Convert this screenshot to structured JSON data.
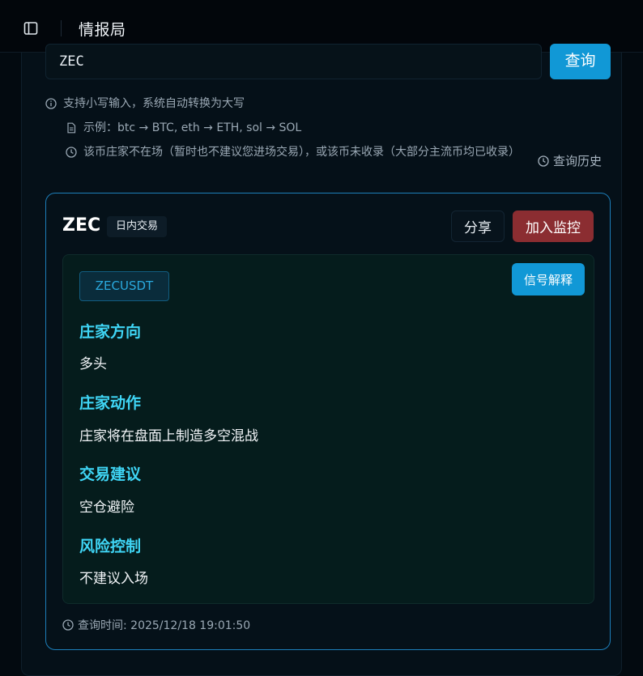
{
  "header": {
    "title": "情报局",
    "sidebar_toggle_icon": "sidebar-toggle-icon"
  },
  "search": {
    "value": "ZEC",
    "placeholder": "",
    "button_label": "查询"
  },
  "hints": {
    "info_text": "支持小写输入，系统自动转换为大写",
    "example_text": "示例：btc → BTC, eth → ETH, sol → SOL",
    "warning_text": "该币庄家不在场（暂时也不建议您进场交易），或该币未收录（大部分主流币均已收录）",
    "history_label": "查询历史"
  },
  "result": {
    "symbol": "ZEC",
    "mode": "日内交易",
    "share_label": "分享",
    "monitor_label": "加入监控",
    "pair": "ZECUSDT",
    "explain_label": "信号解释",
    "sections": [
      {
        "heading": "庄家方向",
        "value": "多头"
      },
      {
        "heading": "庄家动作",
        "value": "庄家将在盘面上制造多空混战"
      },
      {
        "heading": "交易建议",
        "value": "空仓避险"
      },
      {
        "heading": "风险控制",
        "value": "不建议入场"
      }
    ],
    "query_time": "查询时间: 2025/12/18 19:01:50"
  },
  "colors": {
    "accent": "#1198d6",
    "danger": "#8b2d31",
    "heading": "#3fd5f5",
    "background": "#030a10"
  }
}
